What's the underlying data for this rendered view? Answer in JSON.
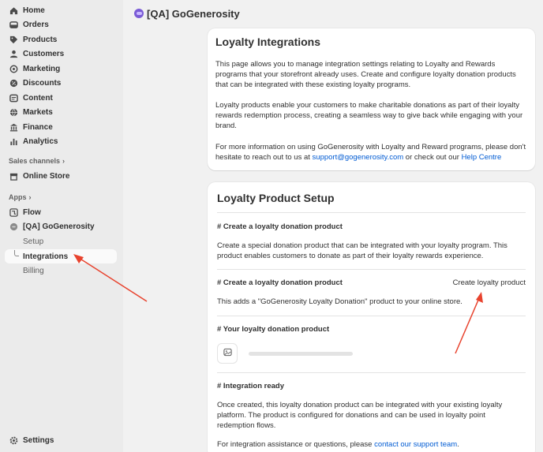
{
  "sidebar": {
    "items": [
      {
        "label": "Home",
        "icon": "home-icon"
      },
      {
        "label": "Orders",
        "icon": "orders-icon"
      },
      {
        "label": "Products",
        "icon": "tag-icon"
      },
      {
        "label": "Customers",
        "icon": "person-icon"
      },
      {
        "label": "Marketing",
        "icon": "target-icon"
      },
      {
        "label": "Discounts",
        "icon": "discount-icon"
      },
      {
        "label": "Content",
        "icon": "content-icon"
      },
      {
        "label": "Markets",
        "icon": "globe-icon"
      },
      {
        "label": "Finance",
        "icon": "bank-icon"
      },
      {
        "label": "Analytics",
        "icon": "chart-icon"
      }
    ],
    "sales_channels_label": "Sales channels",
    "online_store": "Online Store",
    "apps_label": "Apps",
    "flow": "Flow",
    "app_name": "[QA] GoGenerosity",
    "sub_items": [
      "Setup",
      "Integrations",
      "Billing"
    ],
    "settings": "Settings"
  },
  "header": {
    "title": "[QA] GoGenerosity"
  },
  "loyalty_integrations": {
    "title": "Loyalty Integrations",
    "p1": "This page allows you to manage integration settings relating to Loyalty and Rewards programs that your storefront already uses. Create and configure loyalty donation products that can be integrated with these existing loyalty programs.",
    "p2": "Loyalty products enable your customers to make charitable donations as part of their loyalty rewards redemption process, creating a seamless way to give back while engaging with your brand.",
    "p3_prefix": "For more information on using GoGenerosity with Loyalty and Reward programs, please don't hesitate to reach out to us at ",
    "p3_email": "support@gogenerosity.com",
    "p3_middle": " or check out our ",
    "p3_link": "Help Centre"
  },
  "loyalty_product_setup": {
    "title": "Loyalty Product Setup",
    "s1_heading": "# Create a loyalty donation product",
    "s1_text": "Create a special donation product that can be integrated with your loyalty program. This product enables customers to donate as part of their loyalty rewards experience.",
    "s2_heading": "# Create a loyalty donation product",
    "s2_button": "Create loyalty product",
    "s2_text": "This adds a \"GoGenerosity Loyalty Donation\" product to your online store.",
    "s3_heading": "# Your loyalty donation product",
    "s4_heading": "# Integration ready",
    "s4_text": "Once created, this loyalty donation product can be integrated with your existing loyalty platform. The product is configured for donations and can be used in loyalty point redemption flows.",
    "s4_assist_prefix": "For integration assistance or questions, please ",
    "s4_assist_link": "contact our support team",
    "s4_assist_suffix": "."
  },
  "colors": {
    "annotation_arrow": "#e8432e",
    "link": "#005bd3",
    "app_logo": "#7a5bd6"
  }
}
